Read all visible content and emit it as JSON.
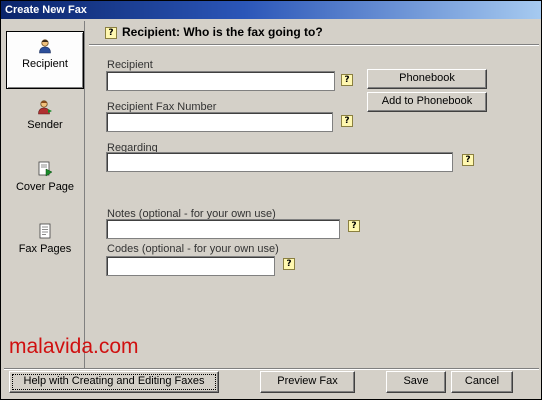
{
  "window": {
    "title": "Create New Fax"
  },
  "sidebar": {
    "items": [
      {
        "label": "Recipient",
        "icon": "recipient-icon",
        "active": true
      },
      {
        "label": "Sender",
        "icon": "sender-icon",
        "active": false
      },
      {
        "label": "Cover Page",
        "icon": "cover-page-icon",
        "active": false
      },
      {
        "label": "Fax Pages",
        "icon": "fax-pages-icon",
        "active": false
      }
    ]
  },
  "header": {
    "title": "Recipient:  Who is the fax going to?",
    "help_glyph": "?"
  },
  "form": {
    "recipient_label": "Recipient",
    "recipient_value": "",
    "fax_number_label": "Recipient Fax Number",
    "fax_number_value": "",
    "regarding_label": "Regarding",
    "regarding_value": "",
    "notes_label": "Notes (optional - for your own use)",
    "notes_value": "",
    "codes_label": "Codes (optional - for your own use)",
    "codes_value": "",
    "phonebook_button": "Phonebook",
    "add_phonebook_button": "Add to Phonebook"
  },
  "watermark": "malavida.com",
  "footer": {
    "help_button": "Help with Creating and Editing Faxes",
    "preview_button": "Preview Fax",
    "save_button": "Save",
    "cancel_button": "Cancel"
  }
}
